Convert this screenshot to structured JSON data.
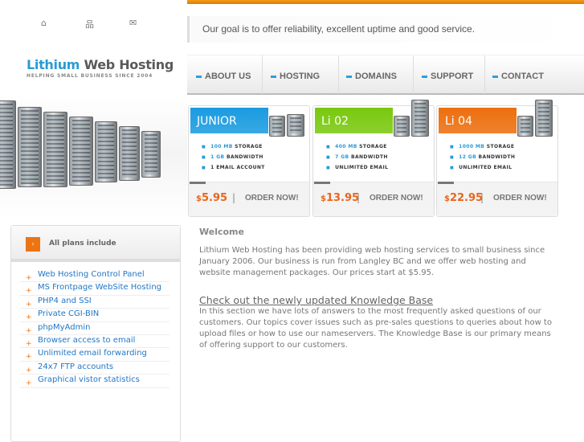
{
  "top_icons": [
    "home-icon",
    "sitemap-icon",
    "mail-icon"
  ],
  "logo": {
    "part1": "Lithium",
    "part2": " Web Hosting",
    "slogan": "HELPING SMALL BUSINESS SINCE 2004"
  },
  "tagline": "Our goal is to offer reliability, excellent uptime and good service.",
  "nav": [
    "ABOUT US",
    "HOSTING",
    "DOMAINS",
    "SUPPORT",
    "CONTACT"
  ],
  "plans": [
    {
      "name": "JUNIOR",
      "color": "#1a9be0",
      "features": [
        {
          "hl": "100 MB",
          "rest": " STORAGE"
        },
        {
          "hl": "1 GB",
          "rest": " BANDWIDTH"
        },
        {
          "hl": "",
          "rest": "1 EMAIL ACCOUNT"
        }
      ],
      "currency": "$",
      "price": "5.95",
      "order": "ORDER NOW!"
    },
    {
      "name": "Li 02",
      "color": "#79c80e",
      "features": [
        {
          "hl": "400 MB",
          "rest": " STORAGE"
        },
        {
          "hl": "7 GB",
          "rest": " BANDWIDTH"
        },
        {
          "hl": "",
          "rest": "UNLIMITED EMAIL"
        }
      ],
      "currency": "$",
      "price": "13.95",
      "order": "ORDER NOW!"
    },
    {
      "name": "Li 04",
      "color": "#ec6f0e",
      "features": [
        {
          "hl": "1000 MB",
          "rest": " STORAGE"
        },
        {
          "hl": "12 GB",
          "rest": " BANDWIDTH"
        },
        {
          "hl": "",
          "rest": "UNLIMITED EMAIL"
        }
      ],
      "currency": "$",
      "price": "22.95",
      "order": "ORDER NOW!"
    }
  ],
  "sidebar": {
    "title": "All plans include",
    "items": [
      "Web Hosting Control Panel",
      "MS Frontpage WebSite Hosting",
      "PHP4 and SSI",
      "Private CGI-BIN",
      "phpMyAdmin",
      "Browser access to email",
      "Unlimited email forwarding",
      "24x7 FTP accounts",
      "Graphical vistor statistics"
    ]
  },
  "main": {
    "title": "Welcome",
    "intro": "Lithium Web Hosting has been providing web hosting services to small business since January 2006. Our business is run from Langley BC and we offer web hosting and website management packages. Our prices start at $5.95.",
    "kb_link": "Check out the newly updated Knowledge Base",
    "kb_text": "In this section we have lots of answers to the most frequently asked questions of our customers. Our topics cover issues such as pre-sales questions to queries about how to upload files or how to use our nameservers. The Knowledge Base is our primary means of offering support to our customers."
  }
}
